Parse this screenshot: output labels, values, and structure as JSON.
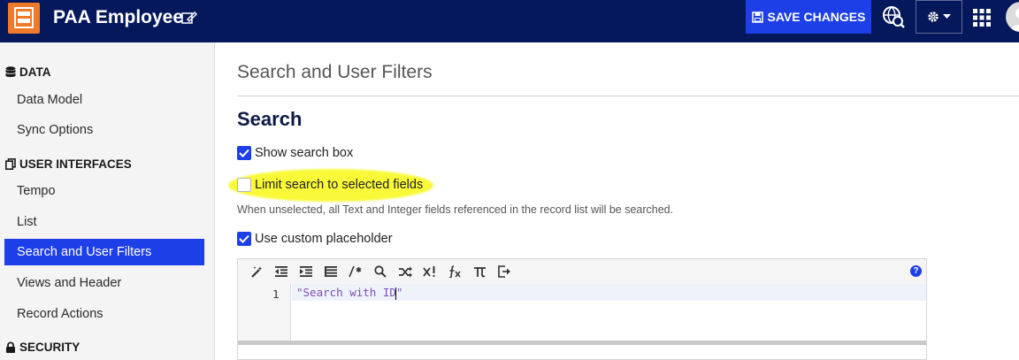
{
  "header": {
    "app_title": "PAA Employee",
    "save_label": "SAVE CHANGES",
    "colors": {
      "bar": "#05185b",
      "accent": "#1d3fe8",
      "app_icon": "#f07a2a"
    }
  },
  "sidebar": {
    "sections": [
      {
        "label": "DATA",
        "icon": "database-icon"
      },
      {
        "label": "USER INTERFACES",
        "icon": "copy-icon"
      },
      {
        "label": "SECURITY",
        "icon": "lock-icon"
      }
    ],
    "items": [
      {
        "label": "Data Model"
      },
      {
        "label": "Sync Options"
      },
      {
        "label": "Tempo"
      },
      {
        "label": "List"
      },
      {
        "label": "Search and User Filters",
        "active": true
      },
      {
        "label": "Views and Header"
      },
      {
        "label": "Record Actions"
      }
    ]
  },
  "main": {
    "page_title": "Search and User Filters",
    "section_title": "Search",
    "options": [
      {
        "label": "Show search box",
        "checked": true
      },
      {
        "label": "Limit search to selected fields",
        "checked": false
      },
      {
        "label": "Use custom placeholder",
        "checked": true
      }
    ],
    "help_text": "When unselected, all Text and Integer fields referenced in the record list will be searched.",
    "editor": {
      "line_number": "1",
      "code_before_cursor": "\"Search with ID",
      "code_after_cursor": "\"",
      "help_icon": "?"
    }
  }
}
